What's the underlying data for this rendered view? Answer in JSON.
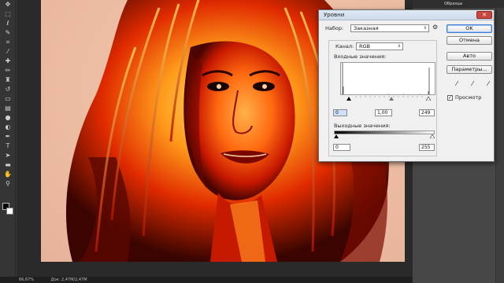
{
  "dialog": {
    "title": "Уровни",
    "preset_label": "Набор:",
    "preset_value": "Заказная",
    "channel_label": "Канал:",
    "channel_value": "RGB",
    "input_levels_label": "Входные значения:",
    "input_black": "0",
    "input_gamma": "1,00",
    "input_white": "249",
    "output_levels_label": "Выходные значения:",
    "output_black": "0",
    "output_white": "255",
    "buttons": {
      "ok": "OK",
      "cancel": "Отмена",
      "auto": "Авто",
      "options": "Параметры..."
    },
    "preview_label": "Просмотр",
    "preview_checked": true
  },
  "panels": {
    "top_tab": "Образцы"
  },
  "statusbar": {
    "zoom": "66,67%",
    "doc": "Док: 2,47M/2,47M"
  },
  "tools": [
    "move-icon",
    "marquee-icon",
    "lasso-icon",
    "quick-select-icon",
    "crop-icon",
    "eyedropper-icon",
    "healing-icon",
    "brush-icon",
    "clone-stamp-icon",
    "history-brush-icon",
    "eraser-icon",
    "gradient-icon",
    "blur-icon",
    "dodge-icon",
    "pen-icon",
    "type-icon",
    "path-select-icon",
    "shape-icon",
    "hand-icon",
    "zoom-icon"
  ]
}
